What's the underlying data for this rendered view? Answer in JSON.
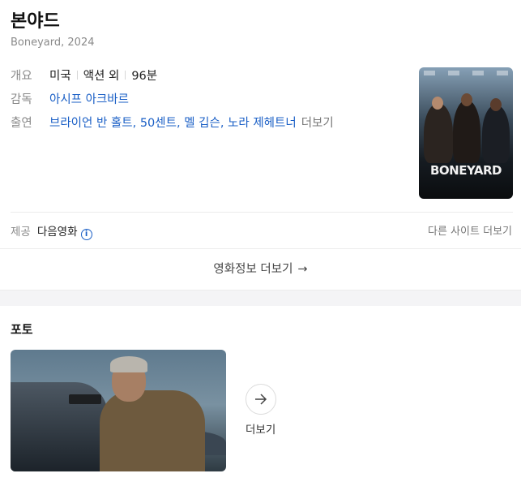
{
  "movie": {
    "title": "본야드",
    "original_title_year": "Boneyard, 2024",
    "overview": {
      "label": "개요",
      "country": "미국",
      "genre": "액션 외",
      "runtime": "96분"
    },
    "director": {
      "label": "감독",
      "name": "아시프 아크바르"
    },
    "cast": {
      "label": "출연",
      "names": [
        "브라이언 반 홀트",
        "50센트",
        "멜 깁슨",
        "노라 제헤트너"
      ],
      "more": "더보기"
    },
    "poster_title": "BONEYARD"
  },
  "provider": {
    "label": "제공",
    "name": "다음영화",
    "info_icon": "i",
    "other_sites": "다른 사이트 더보기"
  },
  "movie_more": {
    "label": "영화정보 더보기",
    "arrow": "→"
  },
  "photos": {
    "title": "포토",
    "more_label": "더보기",
    "more_icon": "arrow-right-icon"
  },
  "colors": {
    "link": "#1a5fc6",
    "muted": "#888888",
    "band": "#f4f4f6"
  }
}
